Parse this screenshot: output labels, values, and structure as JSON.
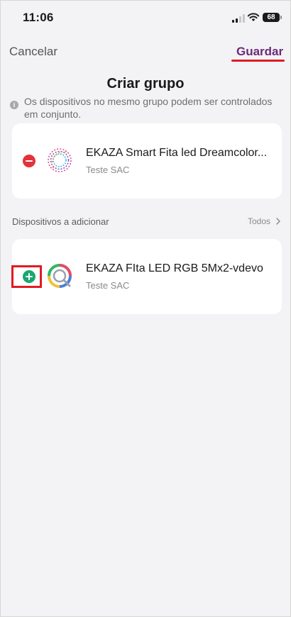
{
  "status": {
    "time": "11:06",
    "battery": "68"
  },
  "nav": {
    "cancel": "Cancelar",
    "save": "Guardar"
  },
  "title": "Criar grupo",
  "info": "Os dispositivos no mesmo grupo podem ser controlados em conjunto.",
  "group_devices": [
    {
      "name": "EKAZA Smart Fita led Dreamcolor...",
      "subtitle": "Teste SAC"
    }
  ],
  "available": {
    "label": "Dispositivos a adicionar",
    "all_label": "Todos",
    "devices": [
      {
        "name": "EKAZA FIta LED RGB 5Mx2-vdevo",
        "subtitle": "Teste SAC"
      }
    ]
  },
  "colors": {
    "remove": "#e5323a",
    "add": "#1aa771",
    "save": "#6b2a7a",
    "highlight": "#e01b24"
  }
}
